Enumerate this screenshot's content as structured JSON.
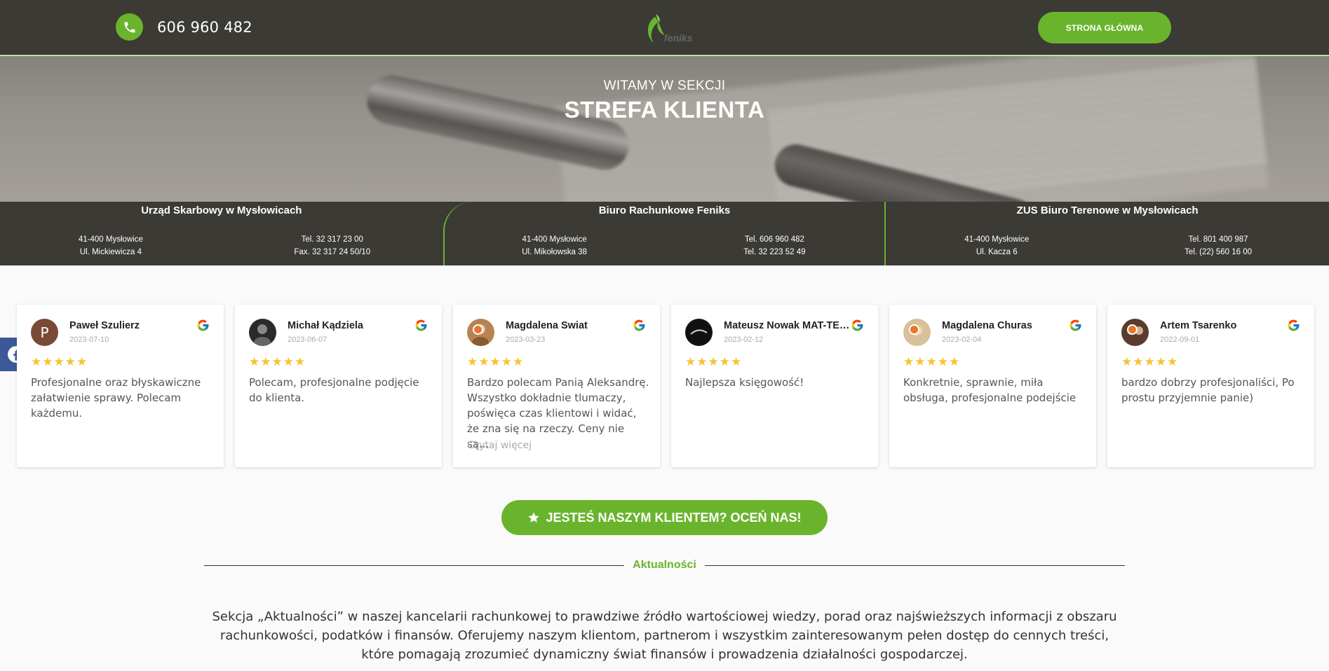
{
  "header": {
    "phone": "606 960 482",
    "logo_text": "feniks",
    "home_button": "STRONA GŁÓWNA"
  },
  "hero": {
    "subtitle": "WITAMY W SEKCJI",
    "title": "STREFA KLIENTA"
  },
  "offices": [
    {
      "title": "Urząd Skarbowy w Mysłowicach",
      "city": "41-400 Mysłowice",
      "street": "Ul. Mickiewicza 4",
      "line1": "Tel.  32 317 23 00",
      "line2": "Fax. 32 317 24 50/10"
    },
    {
      "title": "Biuro Rachunkowe Feniks",
      "city": "41-400 Mysłowice",
      "street": "Ul. Mikołowska 38",
      "line1": "Tel.  606 960 482",
      "line2": "Tel.  32 223 52 49"
    },
    {
      "title": "ZUS Biuro Terenowe w Mysłowicach",
      "city": "41-400 Mysłowice",
      "street": "Ul. Kacza 6",
      "line1": "Tel.  801 400 987",
      "line2": "Tel. (22) 560 16 00"
    }
  ],
  "reviews": [
    {
      "name": "Paweł Szulierz",
      "initial": "P",
      "date": "2023-07-10",
      "stars": "★★★★★",
      "text": "Profesjonalne oraz błyskawiczne załatwienie sprawy. Polecam każdemu.",
      "avatar_color": "#7a4a36"
    },
    {
      "name": "Michał Kądziela",
      "initial": "",
      "date": "2023-06-07",
      "stars": "★★★★★",
      "text": "Polecam, profesjonalne podjęcie do klienta.",
      "avatar_color": "#2a2a2a"
    },
    {
      "name": "Magdalena Swiat",
      "initial": "",
      "date": "2023-03-23",
      "stars": "★★★★★",
      "text": "Bardzo polecam Panią Aleksandrę. Wszystko dokładnie tlumaczy, poświęca czas klientowi i widać, że zna się na rzeczy. Ceny nie są...",
      "more": "Czytaj więcej",
      "avatar_color": "#b58452"
    },
    {
      "name": "Mateusz Nowak MAT-TECH",
      "initial": "",
      "date": "2023-02-12",
      "stars": "★★★★★",
      "text": "Najlepsza księgowość!",
      "avatar_color": "#111111"
    },
    {
      "name": "Magdalena Churas",
      "initial": "",
      "date": "2023-02-04",
      "stars": "★★★★★",
      "text": "Konkretnie, sprawnie, miła obsługa, profesjonalne podejście",
      "avatar_color": "#d8c09a"
    },
    {
      "name": "Artem Tsarenko",
      "initial": "",
      "date": "2022-09-01",
      "stars": "★★★★★",
      "text": "bardzo dobrzy profesjonaliści, Po prostu przyjemnie panie)",
      "avatar_color": "#5a3c2e"
    }
  ],
  "cta": {
    "label": "JESTEŚ NASZYM KLIENTEM? OCEŃ NAS!"
  },
  "news": {
    "heading": "Aktualności",
    "intro": "Sekcja „Aktualności” w naszej kancelarii rachunkowej to prawdziwe źródło wartościowej wiedzy, porad oraz najświeższych informacji z obszaru rachunkowości, podatków i finansów. Oferujemy naszym klientom, partnerom i wszystkim zainteresowanym pełen dostęp do cennych treści, które pomagają zrozumieć dynamiczny świat finansów i prowadzenia działalności gospodarczej."
  },
  "colors": {
    "accent": "#6ab42d",
    "dark": "#3b3a35",
    "star": "#f7c32e",
    "facebook": "#3b5998"
  }
}
